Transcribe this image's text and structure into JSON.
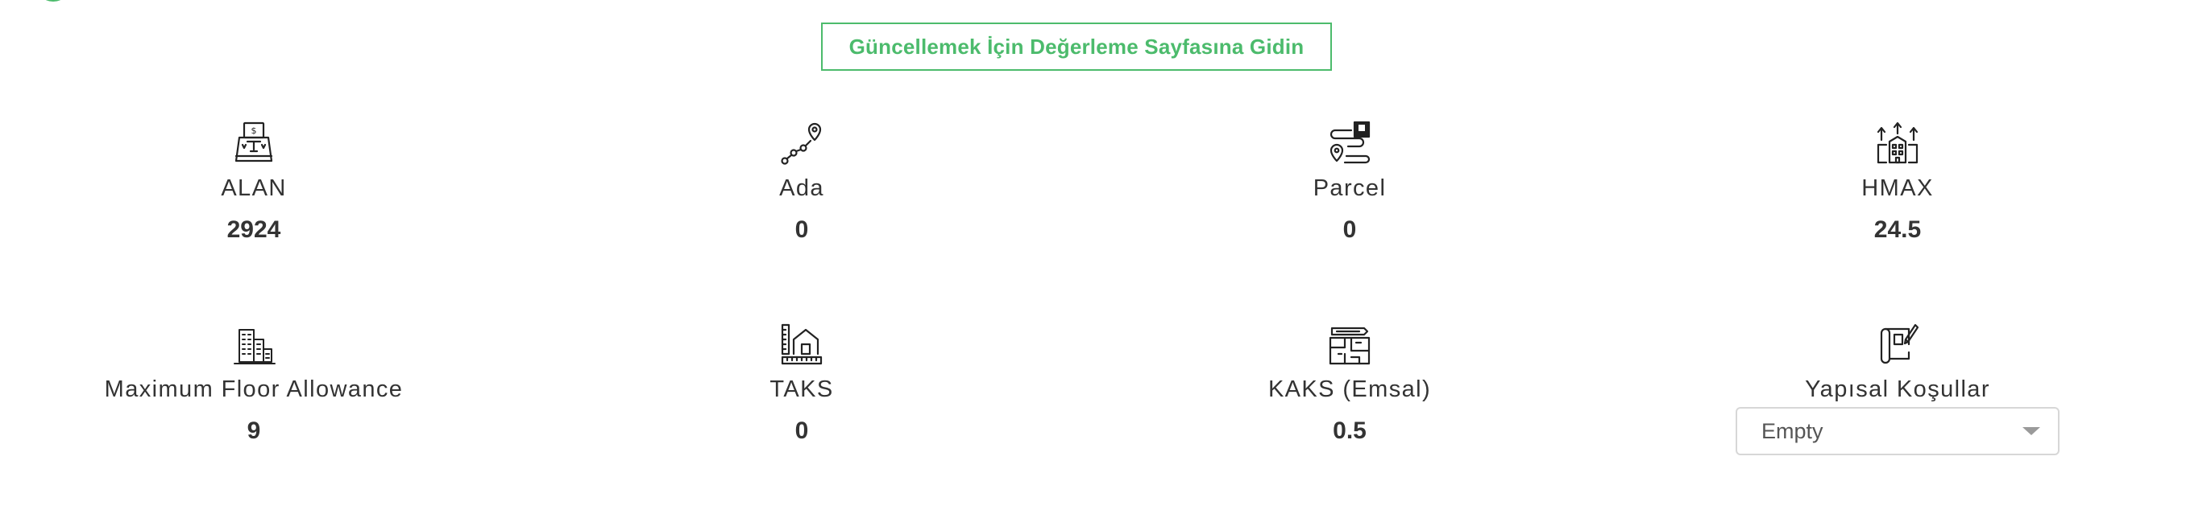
{
  "header": {
    "update_button_label": "Güncellemek İçin Değerleme Sayfasına Gidin"
  },
  "metrics": {
    "alan": {
      "label": "ALAN",
      "value": "2924",
      "icon": "cash-register-icon"
    },
    "ada": {
      "label": "Ada",
      "value": "0",
      "icon": "route-pin-icon"
    },
    "parcel": {
      "label": "Parcel",
      "value": "0",
      "icon": "map-route-icon"
    },
    "hmax": {
      "label": "HMAX",
      "value": "24.5",
      "icon": "building-height-icon"
    },
    "max_floor": {
      "label": "Maximum Floor Allowance",
      "value": "9",
      "icon": "city-buildings-icon"
    },
    "taks": {
      "label": "TAKS",
      "value": "0",
      "icon": "house-measure-icon"
    },
    "kaks": {
      "label": "KAKS (Emsal)",
      "value": "0.5",
      "icon": "floor-plan-icon"
    },
    "yapisal": {
      "label": "Yapısal Koşullar",
      "icon": "blueprint-icon"
    }
  },
  "yapisal_select": {
    "selected_value": "Empty"
  },
  "colors": {
    "accent_green": "#4cbb6c",
    "text": "#333333",
    "select_border": "#d7d7d7"
  }
}
